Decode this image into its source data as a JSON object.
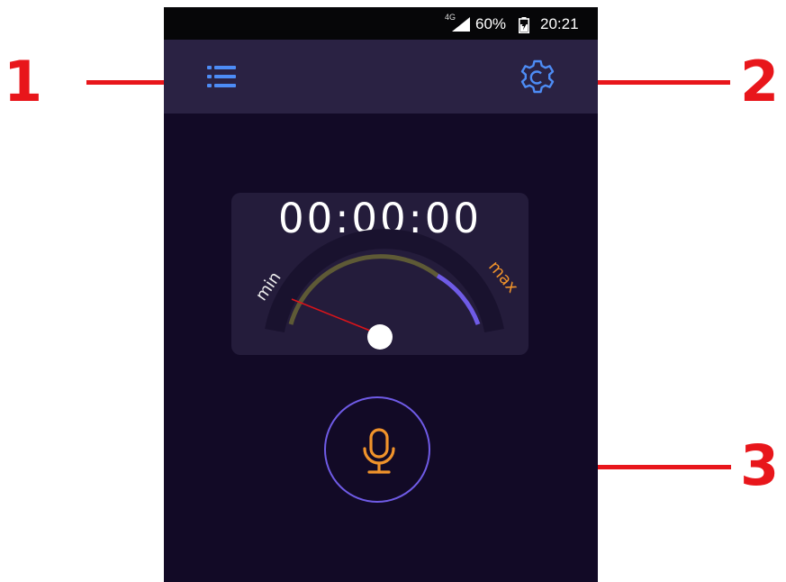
{
  "status_bar": {
    "network": "4G",
    "battery_percent": "60%",
    "time": "20:21"
  },
  "toolbar": {
    "menu_icon": "list-icon",
    "settings_icon": "gear-icon",
    "accent_color": "#4d8cf5"
  },
  "recorder": {
    "timer": "00:00:00",
    "gauge": {
      "min_label": "min",
      "max_label": "max",
      "level": 0
    }
  },
  "mic_button": {
    "icon": "microphone-icon",
    "icon_color": "#f0932b",
    "ring_color": "#6f5be6"
  },
  "callouts": {
    "c1": "1",
    "c2": "2",
    "c3": "3",
    "color": "#e8161b"
  }
}
